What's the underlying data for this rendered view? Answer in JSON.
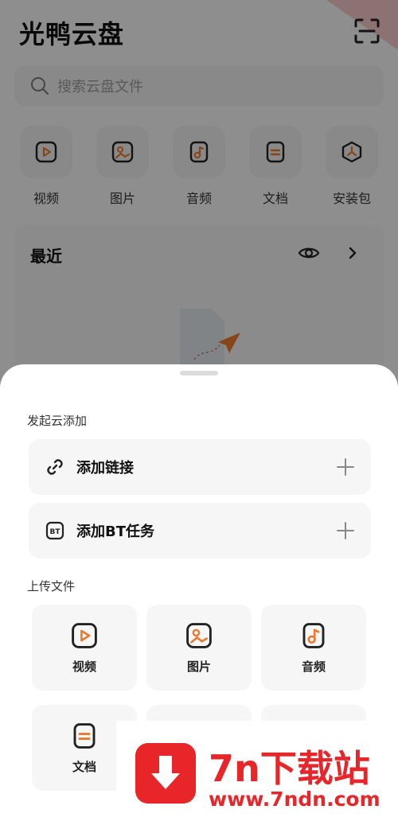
{
  "header": {
    "title": "光鸭云盘"
  },
  "search": {
    "placeholder": "搜索云盘文件"
  },
  "categories": [
    {
      "label": "视频",
      "icon": "video-icon"
    },
    {
      "label": "图片",
      "icon": "image-icon"
    },
    {
      "label": "音频",
      "icon": "audio-icon"
    },
    {
      "label": "文档",
      "icon": "document-icon"
    },
    {
      "label": "安装包",
      "icon": "package-icon"
    }
  ],
  "recent": {
    "title": "最近"
  },
  "sheet": {
    "cloud_add": {
      "label": "发起云添加",
      "items": [
        {
          "label": "添加链接",
          "icon": "link-icon"
        },
        {
          "label": "添加BT任务",
          "icon": "bt-icon"
        }
      ]
    },
    "upload": {
      "label": "上传文件",
      "items": [
        {
          "label": "视频",
          "icon": "video-icon"
        },
        {
          "label": "图片",
          "icon": "image-icon"
        },
        {
          "label": "音频",
          "icon": "audio-icon"
        },
        {
          "label": "文档",
          "icon": "document-icon"
        }
      ]
    }
  },
  "watermark": {
    "title": "7n下载站",
    "url": "www.7ndn.com"
  },
  "colors": {
    "accent": "#e8792e",
    "watermark": "#e8262a"
  }
}
